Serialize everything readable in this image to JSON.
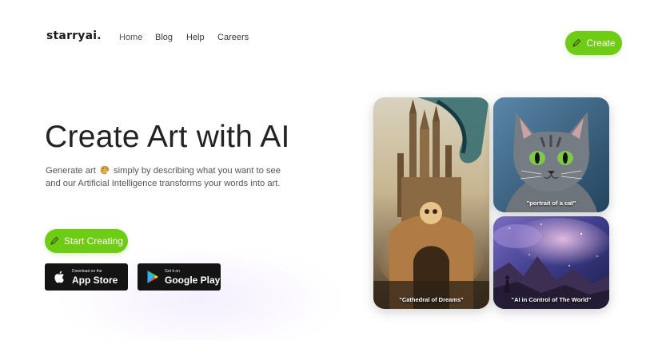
{
  "header": {
    "logo": "starryai.",
    "nav": [
      "Home",
      "Blog",
      "Help",
      "Careers"
    ],
    "create_label": "Create"
  },
  "hero": {
    "title": "Create Art with AI",
    "desc_before_emoji": "Generate art",
    "desc_after_emoji": "simply by describing what you want to see",
    "desc_line2": "and our Artificial Intelligence transforms your words into art.",
    "start_label": "Start Creating"
  },
  "stores": {
    "appstore_small": "Download on the",
    "appstore_big": "App Store",
    "googleplay_small": "Get it on",
    "googleplay_big": "Google Play"
  },
  "gallery": {
    "cathedral_caption": "\"Cathedral of Dreams\"",
    "cat_caption": "\"portrait of a cat\"",
    "nebula_caption": "\"AI in Control of The World\""
  },
  "colors": {
    "accent": "#6fcc15",
    "store_bg": "#141414",
    "title": "#232323"
  },
  "icons": [
    "pencil-icon",
    "artist-palette-emoji",
    "apple-icon",
    "google-play-icon"
  ]
}
